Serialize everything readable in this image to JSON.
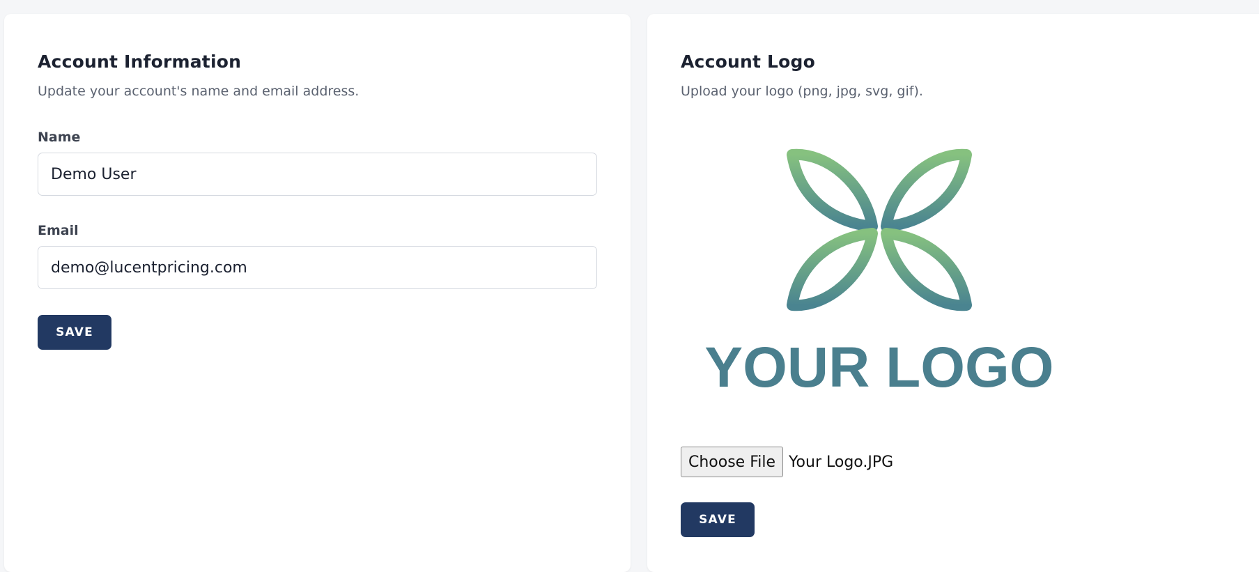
{
  "account_info": {
    "title": "Account Information",
    "subtitle": "Update your account's name and email address.",
    "name_label": "Name",
    "name_value": "Demo User",
    "email_label": "Email",
    "email_value": "demo@lucentpricing.com",
    "save_label": "SAVE"
  },
  "account_logo": {
    "title": "Account Logo",
    "subtitle": "Upload your logo (png, jpg, svg, gif).",
    "logo_text": "YOUR LOGO",
    "choose_file_label": "Choose File",
    "file_name": "Your Logo.JPG",
    "save_label": "SAVE"
  },
  "colors": {
    "primary_button": "#223962",
    "logo_green": "#86c17f",
    "logo_teal": "#4a7f8e",
    "background": "#f5f6f8"
  }
}
